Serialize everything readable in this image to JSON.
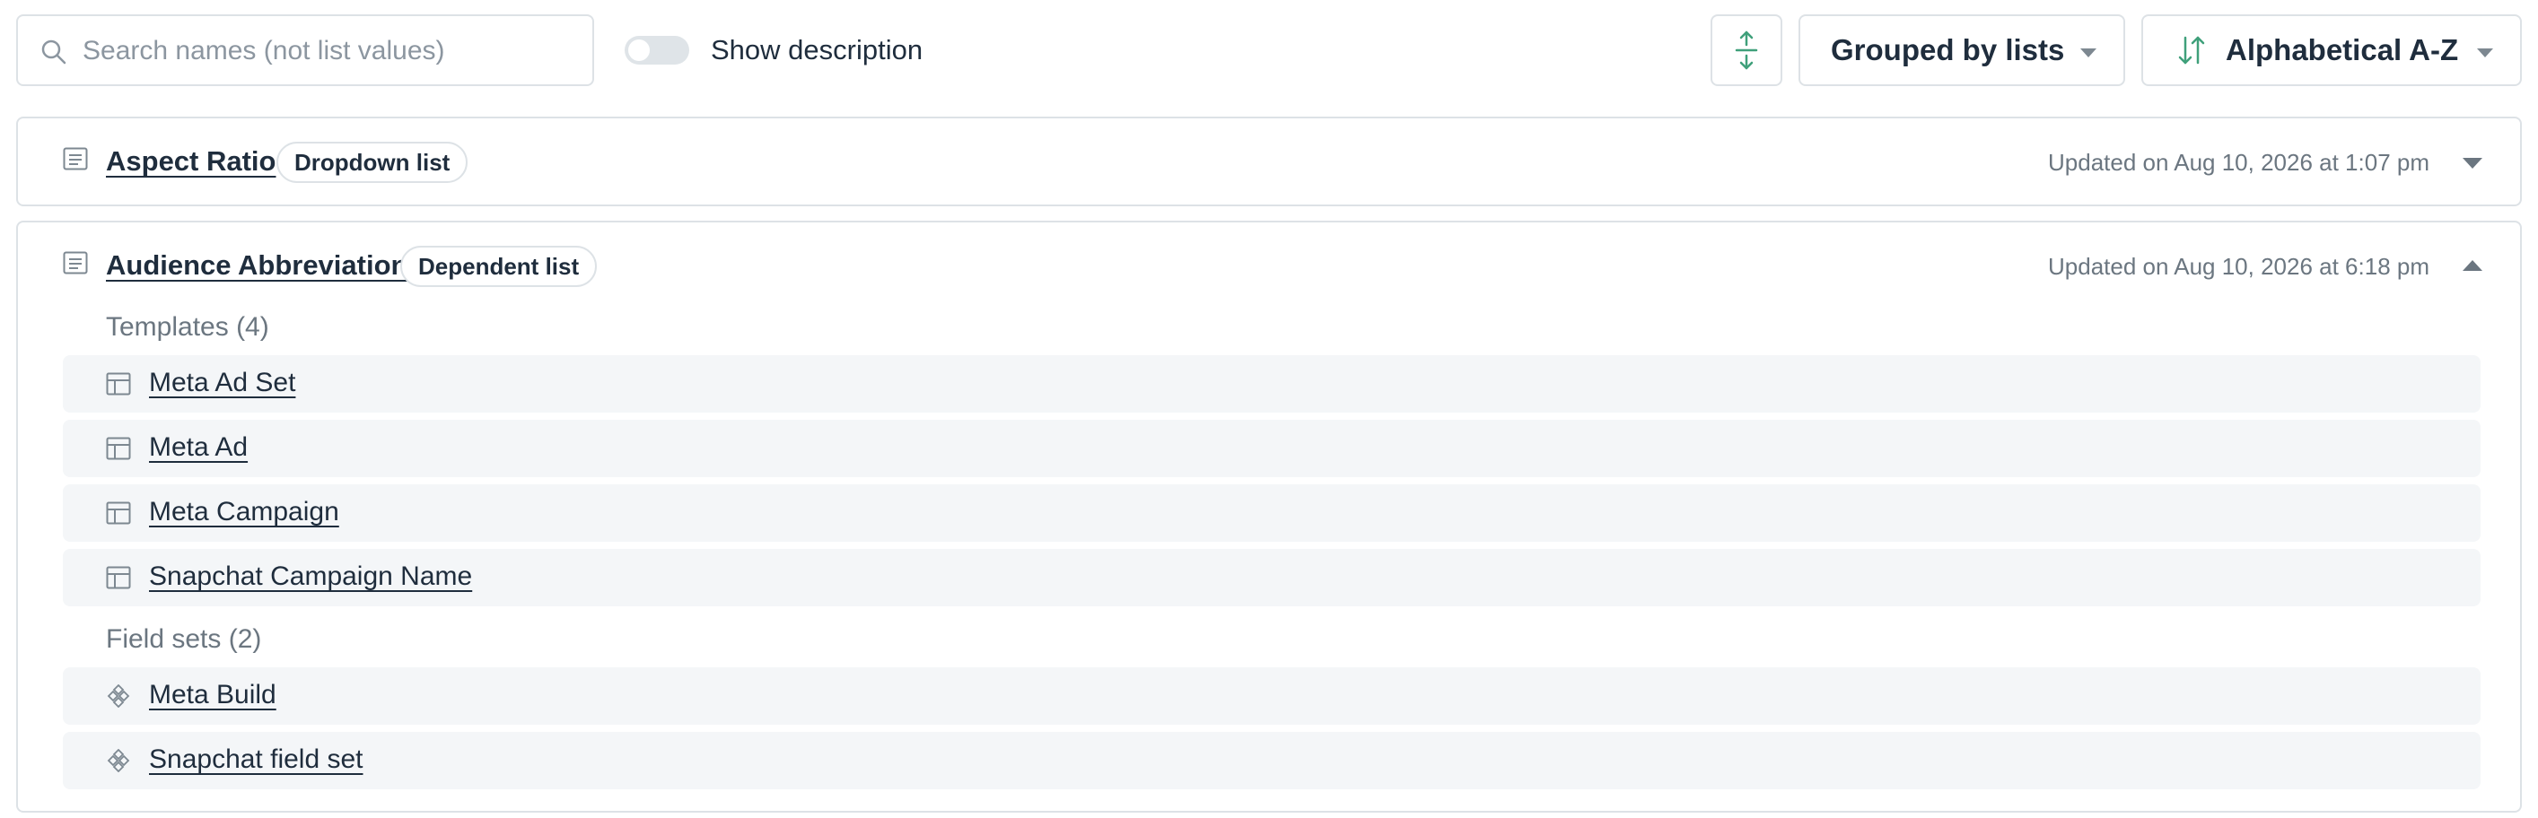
{
  "search": {
    "placeholder": "Search names (not list values)",
    "value": ""
  },
  "toggle": {
    "label": "Show description",
    "on": false
  },
  "group_by": {
    "label": "Grouped by lists"
  },
  "sort": {
    "label": "Alphabetical A-Z"
  },
  "colors": {
    "accent": "#3fa07a",
    "border": "#dde2e6",
    "row_bg": "#f4f6f8",
    "muted": "#6b7680"
  },
  "lists": [
    {
      "name": "Aspect Ratio",
      "type": "Dropdown list",
      "updated": "Updated on Aug 10, 2026 at 1:07 pm",
      "expanded": false
    },
    {
      "name": "Audience Abbreviation",
      "type": "Dependent list",
      "updated": "Updated on Aug 10, 2026 at 6:18 pm",
      "expanded": true,
      "templates_title": "Templates (4)",
      "templates": [
        "Meta Ad Set",
        "Meta Ad",
        "Meta Campaign",
        "Snapchat Campaign Name"
      ],
      "fieldsets_title": "Field sets (2)",
      "fieldsets": [
        "Meta Build",
        "Snapchat field set"
      ]
    }
  ]
}
